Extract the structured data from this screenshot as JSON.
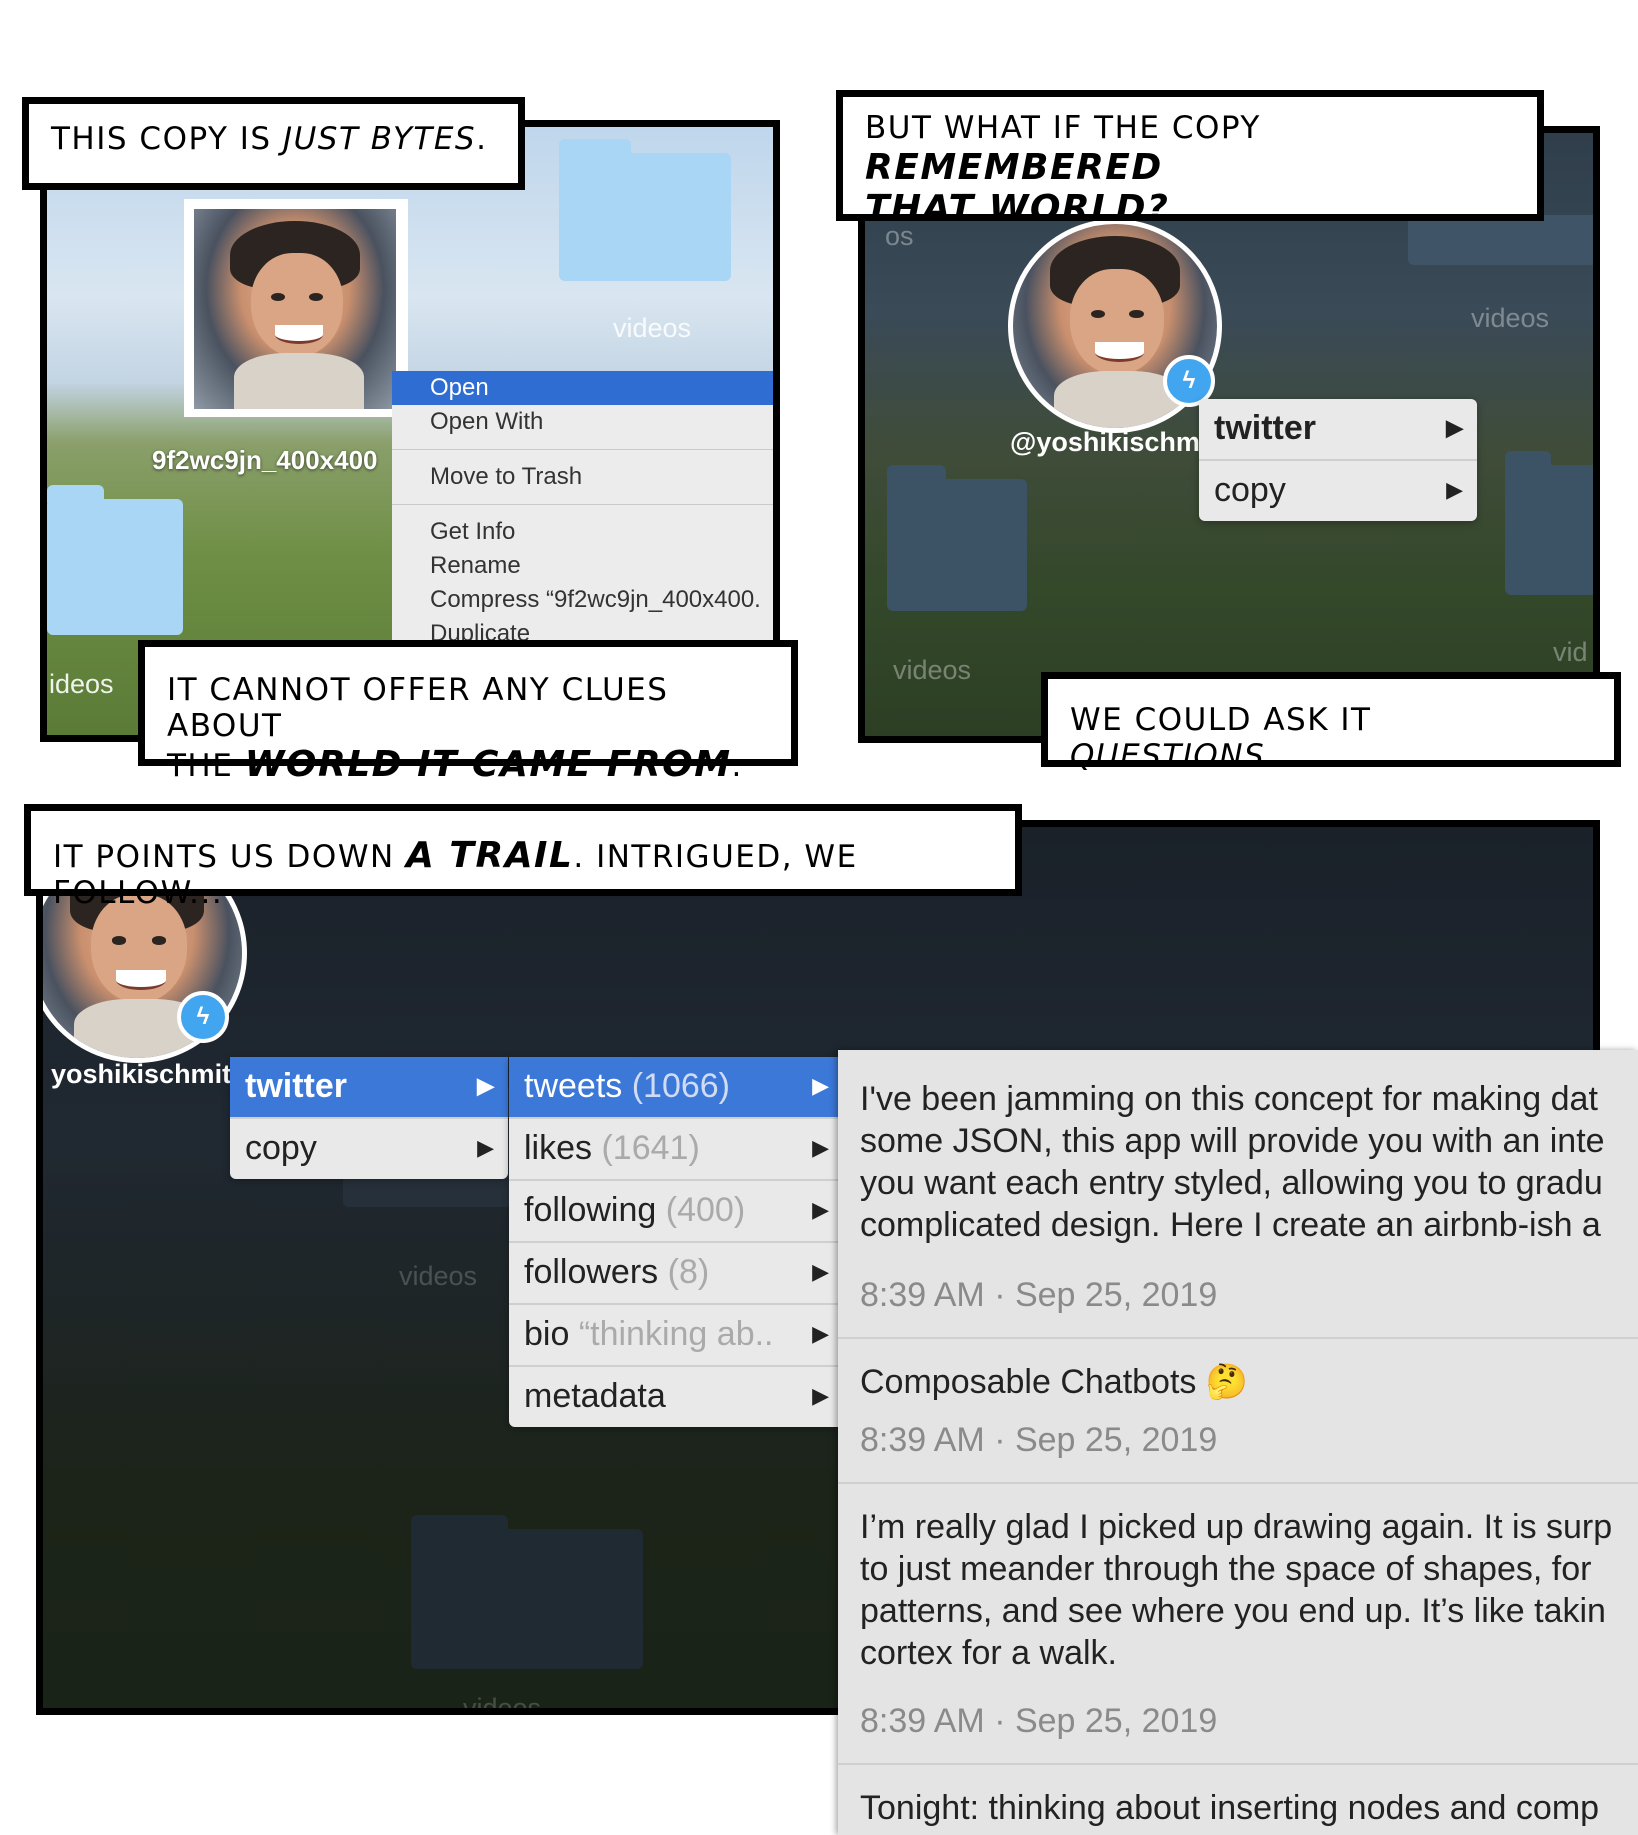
{
  "captions": {
    "c1": {
      "pre": "This copy is ",
      "em": "just bytes",
      "post": "."
    },
    "c2": {
      "pre": "But what if the copy ",
      "em1": "remembered",
      "em2": "that world?"
    },
    "c3": {
      "line1": "It cannot offer any clues about",
      "pre": "the ",
      "em": "world it came from",
      "post": "."
    },
    "c4": {
      "pre": "We could ask it ",
      "em": "questions",
      "post": "..."
    },
    "c5": {
      "pre": "It points us down ",
      "em": "a trail",
      "post": ". Intrigued, we follow..."
    }
  },
  "panel1": {
    "file_name": "9f2wc9jn_400x400",
    "folder_label": "videos",
    "folder_label_partial": "ideos",
    "context_menu": [
      "Open",
      "Open With",
      "Move to Trash",
      "Get Info",
      "Rename",
      "Compress “9f2wc9jn_400x400.",
      "Duplicate"
    ]
  },
  "panel2": {
    "handle": "@yoshikischmi",
    "labels": [
      "videos",
      "videos",
      "vid",
      "os"
    ],
    "menu": [
      "twitter",
      "copy"
    ]
  },
  "panel3": {
    "handle": "yoshikischmitz",
    "folder_label": "videos",
    "folder_label2": "videos",
    "menu1": [
      "twitter",
      "copy"
    ],
    "menu2": [
      {
        "label": "tweets",
        "count": "(1066)"
      },
      {
        "label": "likes",
        "count": "(1641)"
      },
      {
        "label": "following",
        "count": "(400)"
      },
      {
        "label": "followers",
        "count": "(8)"
      },
      {
        "label": "bio",
        "count": "“thinking ab.."
      },
      {
        "label": "metadata",
        "count": ""
      }
    ],
    "tweets": [
      {
        "text": "I've been jamming on this concept for making dat\nsome JSON, this app will provide you with an inte\nyou want each entry styled, allowing you to gradu\ncomplicated design. Here I create an airbnb-ish a",
        "time": "8:39 AM · Sep 25, 2019"
      },
      {
        "text": "Composable Chatbots 🤔",
        "time": "8:39 AM · Sep 25, 2019"
      },
      {
        "text": "I’m really glad I picked up drawing again. It is surp\nto just meander through the space of shapes, for\npatterns, and see where you end up. It’s like takin\ncortex for a walk.",
        "time": "8:39 AM · Sep 25, 2019"
      },
      {
        "text": "Tonight: thinking about inserting nodes and comp",
        "time": ""
      }
    ]
  },
  "icons": {
    "badge": "lightning-bolt-icon",
    "submenu_arrow": "triangle-right-icon"
  },
  "colors": {
    "selection_blue": "#3b78d8",
    "badge_blue": "#41a5f0",
    "menu_bg": "#e9e9e9"
  }
}
